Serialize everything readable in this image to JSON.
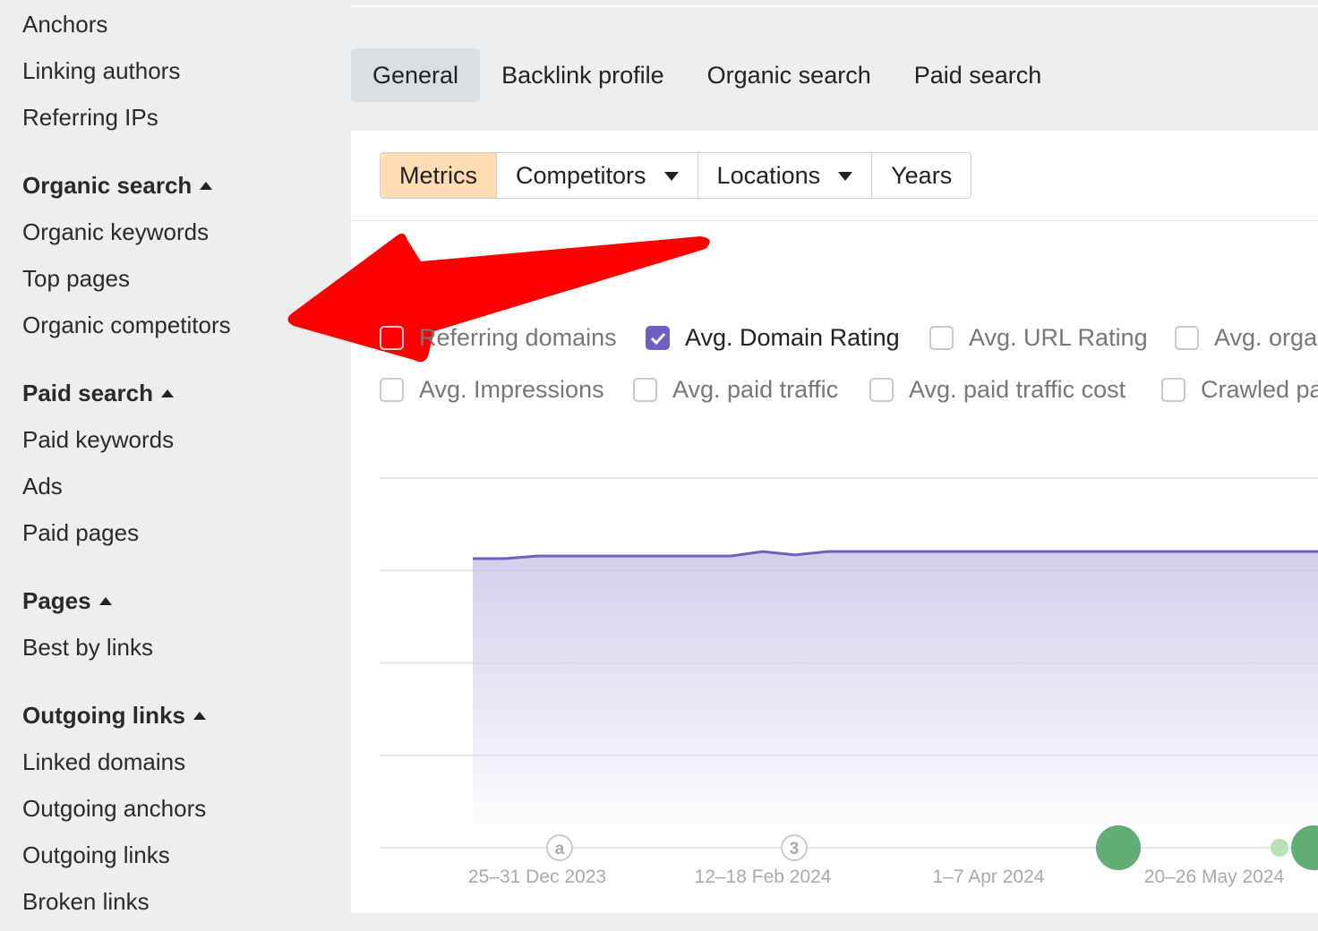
{
  "sidebar": {
    "items_top": [
      "Anchors",
      "Linking authors",
      "Referring IPs"
    ],
    "sections": [
      {
        "title": "Organic search",
        "items": [
          "Organic keywords",
          "Top pages",
          "Organic competitors"
        ]
      },
      {
        "title": "Paid search",
        "items": [
          "Paid keywords",
          "Ads",
          "Paid pages"
        ]
      },
      {
        "title": "Pages",
        "items": [
          "Best by links"
        ]
      },
      {
        "title": "Outgoing links",
        "items": [
          "Linked domains",
          "Outgoing anchors",
          "Outgoing links",
          "Broken links"
        ]
      }
    ]
  },
  "tabs": [
    {
      "label": "General",
      "active": true
    },
    {
      "label": "Backlink profile"
    },
    {
      "label": "Organic search"
    },
    {
      "label": "Paid search"
    }
  ],
  "segments": [
    {
      "label": "Metrics",
      "active": true
    },
    {
      "label": "Competitors",
      "dropdown": true
    },
    {
      "label": "Locations",
      "dropdown": true
    },
    {
      "label": "Years"
    }
  ],
  "checkboxes": [
    {
      "label": "Referring domains",
      "checked": false
    },
    {
      "label": "Avg. Domain Rating",
      "checked": true
    },
    {
      "label": "Avg. URL Rating",
      "checked": false
    },
    {
      "label": "Avg. orga",
      "checked": false
    },
    {
      "label": "Avg. Impressions",
      "checked": false
    },
    {
      "label": "Avg. paid traffic",
      "checked": false
    },
    {
      "label": "Avg. paid traffic cost",
      "checked": false
    },
    {
      "label": "Crawled pa",
      "checked": false
    }
  ],
  "colors": {
    "accent": "#6f5fc3",
    "active_segment": "#fedcb3",
    "annotation_red": "#ff0000",
    "event_green": "#5aa86e"
  },
  "chart_data": {
    "type": "area",
    "series": [
      {
        "name": "Avg. Domain Rating",
        "color": "#6f5fc3",
        "points": [
          [
            "11–17 Dec 2023",
            78.2
          ],
          [
            "18–24 Dec 2023",
            78.2
          ],
          [
            "25–31 Dec 2023",
            78.9
          ],
          [
            "1–7 Jan 2024",
            78.9
          ],
          [
            "8–14 Jan 2024",
            78.9
          ],
          [
            "15–21 Jan 2024",
            78.9
          ],
          [
            "22–28 Jan 2024",
            78.9
          ],
          [
            "29 Jan–4 Feb 2024",
            78.9
          ],
          [
            "5–11 Feb 2024",
            78.9
          ],
          [
            "12–18 Feb 2024",
            80.1
          ],
          [
            "19–25 Feb 2024",
            79.2
          ],
          [
            "26 Feb–3 Mar 2024",
            80.1
          ],
          [
            "4–10 Mar 2024",
            80.1
          ],
          [
            "11–17 Mar 2024",
            80.1
          ],
          [
            "18–24 Mar 2024",
            80.1
          ],
          [
            "25–31 Mar 2024",
            80.1
          ],
          [
            "1–7 Apr 2024",
            80.1
          ],
          [
            "8–14 Apr 2024",
            80.1
          ],
          [
            "15–21 Apr 2024",
            80.1
          ],
          [
            "22–28 Apr 2024",
            80.1
          ],
          [
            "29 Apr–5 May 2024",
            80.1
          ],
          [
            "6–12 May 2024",
            80.1
          ],
          [
            "13–19 May 2024",
            80.1
          ],
          [
            "20–26 May 2024",
            80.1
          ],
          [
            "27 May–2 Jun 2024",
            80.1
          ]
        ]
      }
    ],
    "x_tick_labels": [
      "25–31 Dec 2023",
      "12–18 Feb 2024",
      "1–7 Apr 2024",
      "20–26 May 2024"
    ],
    "ylim": [
      0,
      100
    ],
    "grid": true,
    "events": [
      {
        "week": "1–7 Jan 2024",
        "label": "a",
        "kind": "outline"
      },
      {
        "week": "19–25 Feb 2024",
        "label": "3",
        "kind": "outline"
      },
      {
        "week": "22–28 Apr 2024",
        "kind": "green-large"
      },
      {
        "week": "27 May–2 Jun 2024",
        "kind": "green-small"
      },
      {
        "week": "3–9 Jun 2024",
        "kind": "green-large"
      }
    ]
  }
}
